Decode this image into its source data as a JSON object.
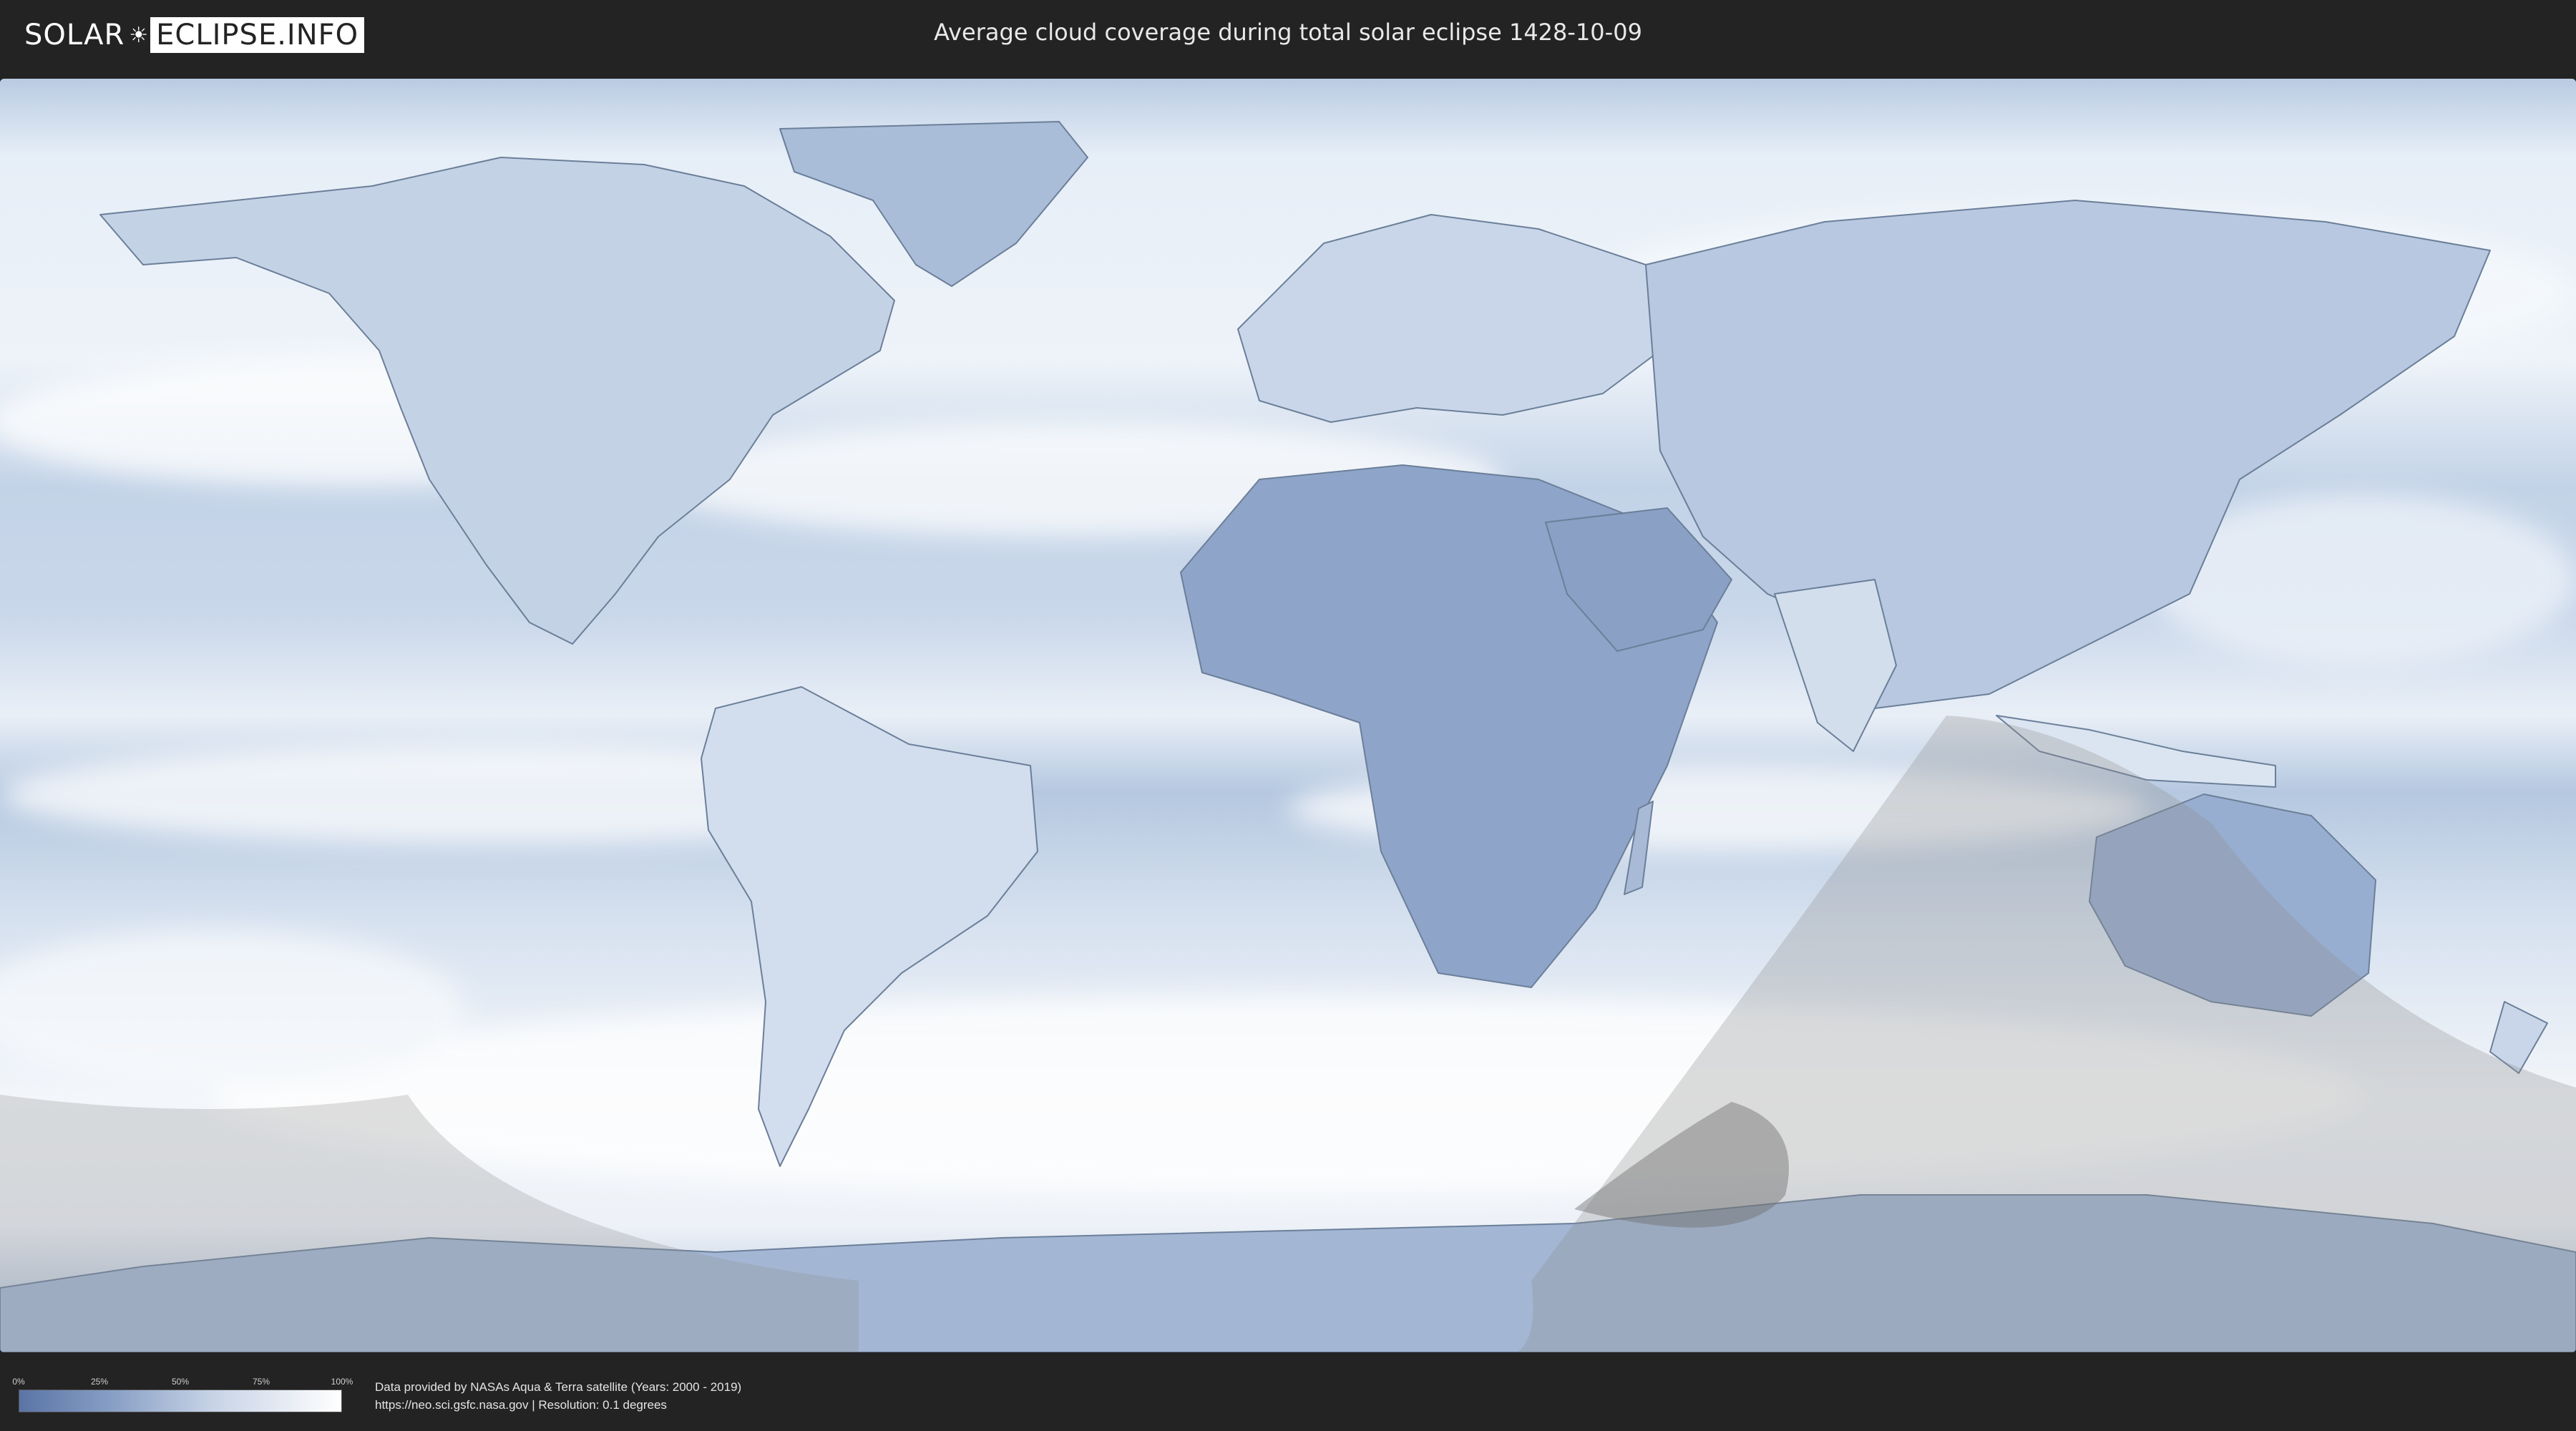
{
  "header": {
    "logo_left": "SOLAR",
    "logo_right": "ECLIPSE.INFO",
    "title": "Average cloud coverage during total solar eclipse 1428-10-09"
  },
  "legend": {
    "ticks": [
      "0%",
      "25%",
      "50%",
      "75%",
      "100%"
    ],
    "colors": [
      "#5a74a6",
      "#ffffff"
    ]
  },
  "footer": {
    "credit_line1": "Data provided by NASAs Aqua & Terra satellite (Years: 2000 - 2019)",
    "credit_line2": "https://neo.sci.gsfc.nasa.gov | Resolution: 0.1 degrees"
  },
  "map": {
    "style": "equirectangular cloud-coverage world map",
    "colors": {
      "clear": "#5a74a6",
      "cloudy": "#ffffff",
      "land_outline": "#6b7f99",
      "night_shade": "#9a9a9a"
    }
  }
}
